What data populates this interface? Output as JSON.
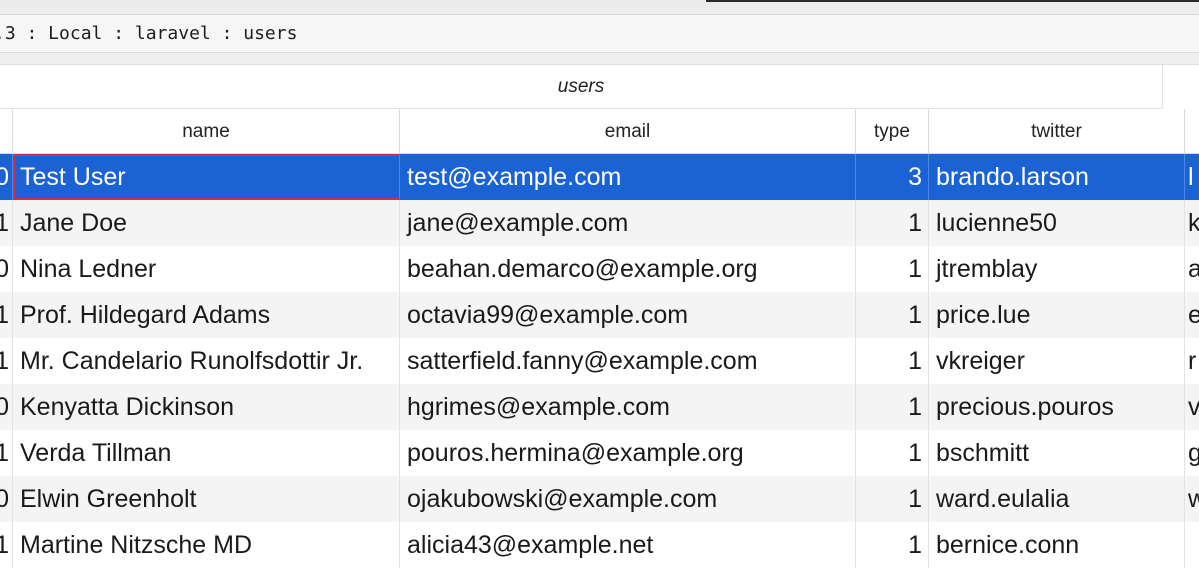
{
  "breadcrumb": ".3 : Local : laravel : users",
  "table": {
    "title": "users",
    "columns": {
      "name": "name",
      "email": "email",
      "type": "type",
      "twitter": "twitter"
    },
    "rows": [
      {
        "lead": "0",
        "name": "Test User",
        "email": "test@example.com",
        "type": "3",
        "twitter": "brando.larson",
        "next": "l",
        "selected": true
      },
      {
        "lead": "1",
        "name": "Jane Doe",
        "email": "jane@example.com",
        "type": "1",
        "twitter": "lucienne50",
        "next": "k"
      },
      {
        "lead": "0",
        "name": "Nina Ledner",
        "email": "beahan.demarco@example.org",
        "type": "1",
        "twitter": "jtremblay",
        "next": "a"
      },
      {
        "lead": "1",
        "name": "Prof. Hildegard Adams",
        "email": "octavia99@example.com",
        "type": "1",
        "twitter": "price.lue",
        "next": "e"
      },
      {
        "lead": "1",
        "name": "Mr. Candelario Runolfsdottir Jr.",
        "email": "satterfield.fanny@example.com",
        "type": "1",
        "twitter": "vkreiger",
        "next": "r"
      },
      {
        "lead": "0",
        "name": "Kenyatta Dickinson",
        "email": "hgrimes@example.com",
        "type": "1",
        "twitter": "precious.pouros",
        "next": "v"
      },
      {
        "lead": "1",
        "name": "Verda Tillman",
        "email": "pouros.hermina@example.org",
        "type": "1",
        "twitter": "bschmitt",
        "next": "g"
      },
      {
        "lead": "0",
        "name": "Elwin Greenholt",
        "email": "ojakubowski@example.com",
        "type": "1",
        "twitter": "ward.eulalia",
        "next": "w"
      },
      {
        "lead": "1",
        "name": "Martine Nitzsche MD",
        "email": "alicia43@example.net",
        "type": "1",
        "twitter": "bernice.conn",
        "next": ""
      }
    ]
  },
  "colors": {
    "selection": "#1b63d4",
    "focus_border": "#c8324a",
    "stripe": "#f4f4f4"
  }
}
